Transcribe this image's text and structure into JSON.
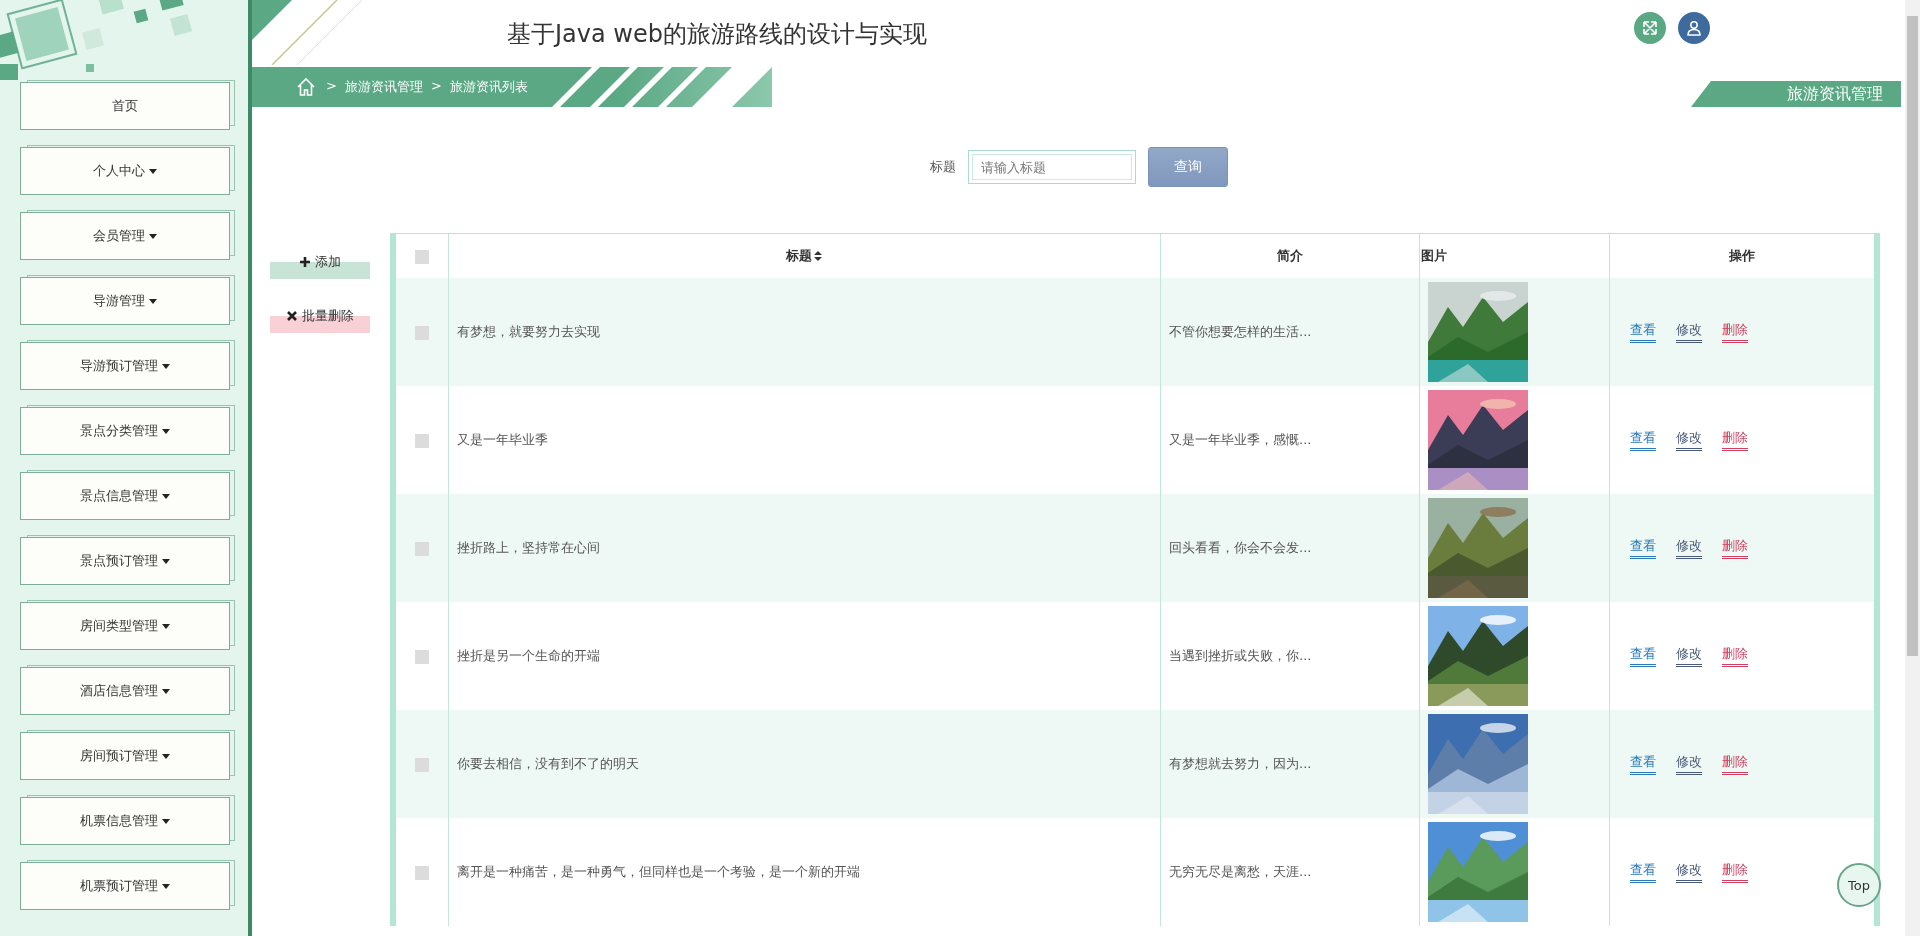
{
  "sidebar": {
    "items": [
      {
        "label": "首页",
        "kind": "link"
      },
      {
        "label": "个人中心",
        "kind": "menu"
      },
      {
        "label": "会员管理",
        "kind": "menu"
      },
      {
        "label": "导游管理",
        "kind": "menu"
      },
      {
        "label": "导游预订管理",
        "kind": "menu"
      },
      {
        "label": "景点分类管理",
        "kind": "menu"
      },
      {
        "label": "景点信息管理",
        "kind": "menu"
      },
      {
        "label": "景点预订管理",
        "kind": "menu"
      },
      {
        "label": "房间类型管理",
        "kind": "menu"
      },
      {
        "label": "酒店信息管理",
        "kind": "menu"
      },
      {
        "label": "房间预订管理",
        "kind": "menu"
      },
      {
        "label": "机票信息管理",
        "kind": "menu"
      },
      {
        "label": "机票预订管理",
        "kind": "menu"
      }
    ]
  },
  "header": {
    "title": "基于Java web的旅游路线的设计与实现"
  },
  "breadcrumb": {
    "separator": ">",
    "items": [
      "旅游资讯管理",
      "旅游资讯列表"
    ]
  },
  "page_tag": "旅游资讯管理",
  "search": {
    "label": "标题",
    "placeholder": "请输入标题",
    "button": "查询"
  },
  "toolbar": [
    {
      "kind": "add",
      "label": "添加"
    },
    {
      "kind": "delete",
      "label": "批量删除"
    }
  ],
  "table": {
    "select_all_checked": false,
    "columns": [
      {
        "label": "标题",
        "sortable": true
      },
      {
        "label": "简介",
        "sortable": false
      },
      {
        "label": "图片",
        "sortable": false
      },
      {
        "label": "操作",
        "sortable": false
      }
    ],
    "rows": [
      {
        "checked": false,
        "title": "有梦想，就要努力去实现",
        "intro": "不管你想要怎样的生活...",
        "image": {
          "kind": "picture"
        },
        "actions": [
          {
            "kind": "view",
            "label": "查看"
          },
          {
            "kind": "edit",
            "label": "修改"
          },
          {
            "kind": "delete",
            "label": "删除"
          }
        ]
      },
      {
        "checked": false,
        "title": "又是一年毕业季",
        "intro": "又是一年毕业季，感慨...",
        "image": {
          "kind": "picture"
        },
        "actions": [
          {
            "kind": "view",
            "label": "查看"
          },
          {
            "kind": "edit",
            "label": "修改"
          },
          {
            "kind": "delete",
            "label": "删除"
          }
        ]
      },
      {
        "checked": false,
        "title": "挫折路上，坚持常在心间",
        "intro": "回头看看，你会不会发...",
        "image": {
          "kind": "picture"
        },
        "actions": [
          {
            "kind": "view",
            "label": "查看"
          },
          {
            "kind": "edit",
            "label": "修改"
          },
          {
            "kind": "delete",
            "label": "删除"
          }
        ]
      },
      {
        "checked": false,
        "title": "挫折是另一个生命的开端",
        "intro": "当遇到挫折或失败，你...",
        "image": {
          "kind": "picture"
        },
        "actions": [
          {
            "kind": "view",
            "label": "查看"
          },
          {
            "kind": "edit",
            "label": "修改"
          },
          {
            "kind": "delete",
            "label": "删除"
          }
        ]
      },
      {
        "checked": false,
        "title": "你要去相信，没有到不了的明天",
        "intro": "有梦想就去努力，因为...",
        "image": {
          "kind": "picture"
        },
        "actions": [
          {
            "kind": "view",
            "label": "查看"
          },
          {
            "kind": "edit",
            "label": "修改"
          },
          {
            "kind": "delete",
            "label": "删除"
          }
        ]
      },
      {
        "checked": false,
        "title": "离开是一种痛苦，是一种勇气，但同样也是一个考验，是一个新的开端",
        "intro": "无穷无尽是离愁，天涯...",
        "image": {
          "kind": "picture"
        },
        "actions": [
          {
            "kind": "view",
            "label": "查看"
          },
          {
            "kind": "edit",
            "label": "修改"
          },
          {
            "kind": "delete",
            "label": "删除"
          }
        ]
      }
    ]
  },
  "top_button": "Top"
}
